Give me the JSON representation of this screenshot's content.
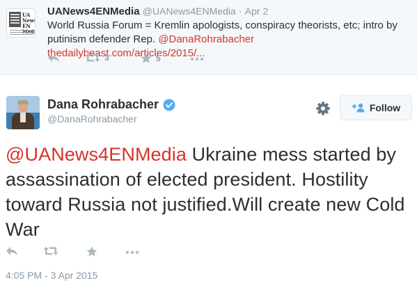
{
  "parent_tweet": {
    "avatar_text": "UA News EN Media",
    "display_name": "UANews4ENMedia",
    "handle": "@UANews4ENMedia",
    "separator": "·",
    "date": "Apr 2",
    "text_plain": "World Russia Forum = Kremlin apologists, conspiracy theorists, etc; intro by putinism defender Rep.",
    "text_mention": "@DanaRohrabacher",
    "text_link": "thedailybeast.com/articles/2015/...",
    "actions": [
      {
        "icon": "reply-icon",
        "count": ""
      },
      {
        "icon": "retweet-icon",
        "count": "3"
      },
      {
        "icon": "favorite-icon",
        "count": "5"
      },
      {
        "icon": "more-icon",
        "count": ""
      }
    ]
  },
  "main_tweet": {
    "display_name": "Dana Rohrabacher",
    "verified_icon": "verified-badge-icon",
    "handle": "@DanaRohrabacher",
    "settings_icon": "gear-icon",
    "follow_label": "Follow",
    "follow_icon": "follow-person-icon",
    "text_mention": "@UANews4ENMedia",
    "text_plain": "Ukraine mess started by assassination of elected president. Hostility toward Russia not justified.Will create new Cold War",
    "actions": [
      {
        "icon": "reply-icon"
      },
      {
        "icon": "retweet-icon"
      },
      {
        "icon": "favorite-icon"
      },
      {
        "icon": "more-icon"
      }
    ],
    "timestamp": "4:05 PM - 3 Apr 2015"
  },
  "colors": {
    "link": "#d4342a",
    "muted": "#8899a6",
    "text": "#292f33",
    "verified": "#55acee",
    "follow_icon": "#55acee",
    "parent_bg": "#f5f8fa"
  }
}
